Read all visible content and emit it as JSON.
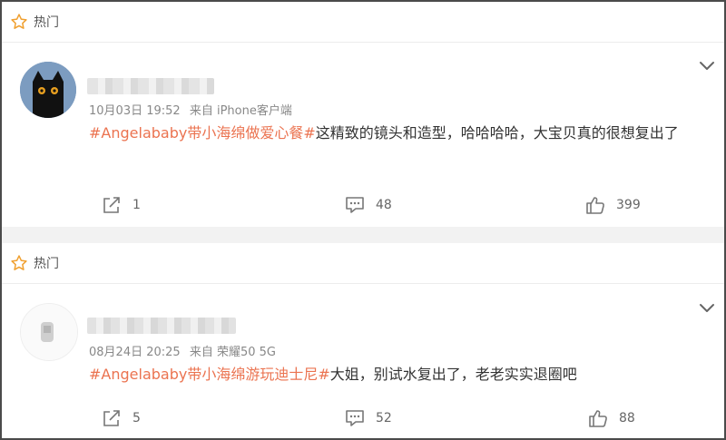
{
  "posts": [
    {
      "section_label": "热门",
      "date": "10月03日 19:52",
      "source": "来自 iPhone客户端",
      "hashtag": "#Angelababy带小海绵做爱心餐#",
      "text": "这精致的镜头和造型，哈哈哈哈，大宝贝真的很想复出了",
      "repost_count": "1",
      "comment_count": "48",
      "like_count": "399"
    },
    {
      "section_label": "热门",
      "date": "08月24日 20:25",
      "source": "来自 荣耀50 5G",
      "hashtag": "#Angelababy带小海绵游玩迪士尼#",
      "text": "大姐，别试水复出了，老老实实退圈吧",
      "repost_count": "5",
      "comment_count": "52",
      "like_count": "88"
    }
  ],
  "colors": {
    "hashtag": "#eb7350",
    "meta": "#888888",
    "icon": "#777777"
  },
  "icons": [
    "star-outline-icon",
    "chevron-down-icon",
    "share-icon",
    "comment-icon",
    "thumbs-up-icon"
  ]
}
